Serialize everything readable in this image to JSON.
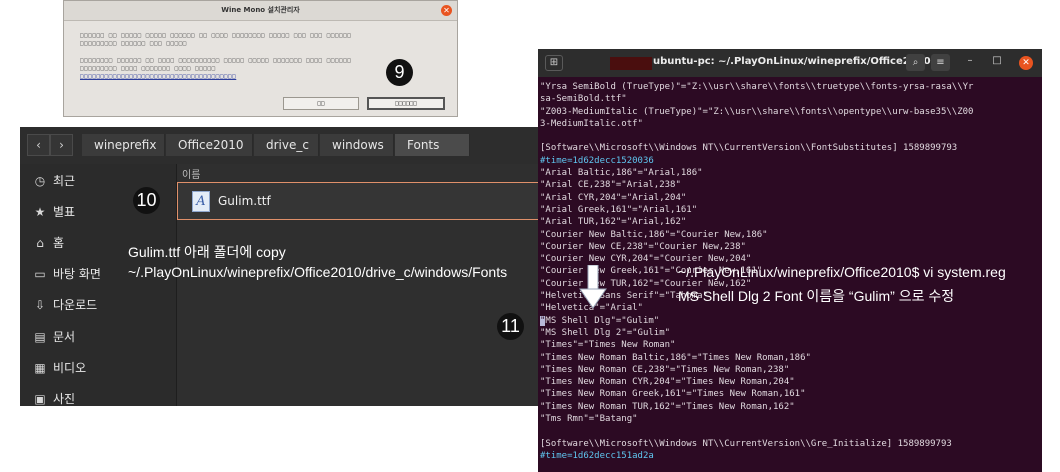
{
  "dialog": {
    "title": "Wine Mono 설치관리자",
    "close_glyph": "✕",
    "lines": [
      "□□□□□□ □□ □□□□□ □□□□□ □□□□□□ □□ □□□□ □□□□□□□□ □□□□□ □□□ □□□ □□□□□□",
      "□□□□□□□□□ □□□□□□ □□□ □□□□□",
      "□□□□□□□□ □□□□□□ □□ □□□□ □□□□□□□□□□ □□□□□ □□□□□ □□□□□□□ □□□□ □□□□□□",
      "□□□□□□□□□ □□□□ □□□□□□□ □□□□ □□□□□",
      "□□□□□□□□□□□□□□□□□□□□□□□□□□□□□□□□□□□□□□"
    ],
    "cancel_label": "□□",
    "install_label": "□□□□□□"
  },
  "files": {
    "nav_back": "‹",
    "nav_forward": "›",
    "breadcrumbs": [
      "wineprefix",
      "Office2010",
      "drive_c",
      "windows",
      "Fonts"
    ],
    "column_name": "이름",
    "sidebar": [
      {
        "icon": "clock-icon",
        "glyph": "◷",
        "label": "최근"
      },
      {
        "icon": "star-icon",
        "glyph": "★",
        "label": "별표"
      },
      {
        "icon": "home-icon",
        "glyph": "⌂",
        "label": "홈"
      },
      {
        "icon": "desktop-icon",
        "glyph": "▭",
        "label": "바탕 화면"
      },
      {
        "icon": "download-icon",
        "glyph": "⇩",
        "label": "다운로드"
      },
      {
        "icon": "document-icon",
        "glyph": "▤",
        "label": "문서"
      },
      {
        "icon": "video-icon",
        "glyph": "▦",
        "label": "비디오"
      },
      {
        "icon": "picture-icon",
        "glyph": "▣",
        "label": "사진"
      }
    ],
    "file_icon_glyph": "A",
    "file_name": "Gulim.ttf"
  },
  "terminal": {
    "new_tab_glyph": "⊞",
    "title": "ubuntu-pc: ~/.PlayOnLinux/wineprefix/Office2010",
    "search_glyph": "⌕",
    "menu_glyph": "≡",
    "minimize_glyph": "–",
    "maximize_glyph": "□",
    "close_glyph": "✕",
    "lines": [
      "\"Yrsa SemiBold (TrueType)\"=\"Z:\\\\usr\\\\share\\\\fonts\\\\truetype\\\\fonts-yrsa-rasa\\\\Yr",
      "sa-SemiBold.ttf\"",
      "\"Z003-MediumItalic (TrueType)\"=\"Z:\\\\usr\\\\share\\\\fonts\\\\opentype\\\\urw-base35\\\\Z00",
      "3-MediumItalic.otf\"",
      "",
      "[Software\\\\Microsoft\\\\Windows NT\\\\CurrentVersion\\\\FontSubstitutes] 1589899793",
      "#time=1d62decc1520036",
      "\"Arial Baltic,186\"=\"Arial,186\"",
      "\"Arial CE,238\"=\"Arial,238\"",
      "\"Arial CYR,204\"=\"Arial,204\"",
      "\"Arial Greek,161\"=\"Arial,161\"",
      "\"Arial TUR,162\"=\"Arial,162\"",
      "\"Courier New Baltic,186\"=\"Courier New,186\"",
      "\"Courier New CE,238\"=\"Courier New,238\"",
      "\"Courier New CYR,204\"=\"Courier New,204\"",
      "\"Courier New Greek,161\"=\"Courier New,161\"",
      "\"Courier New TUR,162\"=\"Courier New,162\"",
      "\"Helvetica Sans Serif\"=\"Tahoma\"",
      "\"Helvetica\"=\"Arial\"",
      "\"MS Shell Dlg\"=\"Gulim\"",
      "\"MS Shell Dlg 2\"=\"Gulim\"",
      "\"Times\"=\"Times New Roman\"",
      "\"Times New Roman Baltic,186\"=\"Times New Roman,186\"",
      "\"Times New Roman CE,238\"=\"Times New Roman,238\"",
      "\"Times New Roman CYR,204\"=\"Times New Roman,204\"",
      "\"Times New Roman Greek,161\"=\"Times New Roman,161\"",
      "\"Times New Roman TUR,162\"=\"Times New Roman,162\"",
      "\"Tms Rmn\"=\"Batang\"",
      "",
      "[Software\\\\Microsoft\\\\Windows NT\\\\CurrentVersion\\\\Gre_Initialize] 1589899793",
      "#time=1d62decc151ad2a"
    ]
  },
  "annotations": {
    "step9": "9",
    "step10": "10",
    "step11": "11",
    "copy_line1": "Gulim.ttf  아래 폴더에 copy",
    "copy_line2": "~/.PlayOnLinux/wineprefix/Office2010/drive_c/windows/Fonts",
    "vi_line1": "~/.PlayOnLinux/wineprefix/Office2010$ vi system.reg",
    "vi_line2": "MS Shell Dlg 2 Font 이름을 “Gulim” 으로 수정"
  },
  "colors": {
    "terminal_bg": "#2c0a23",
    "accent_orange": "#e95420",
    "terminal_highlight": "#5fc6f0"
  }
}
